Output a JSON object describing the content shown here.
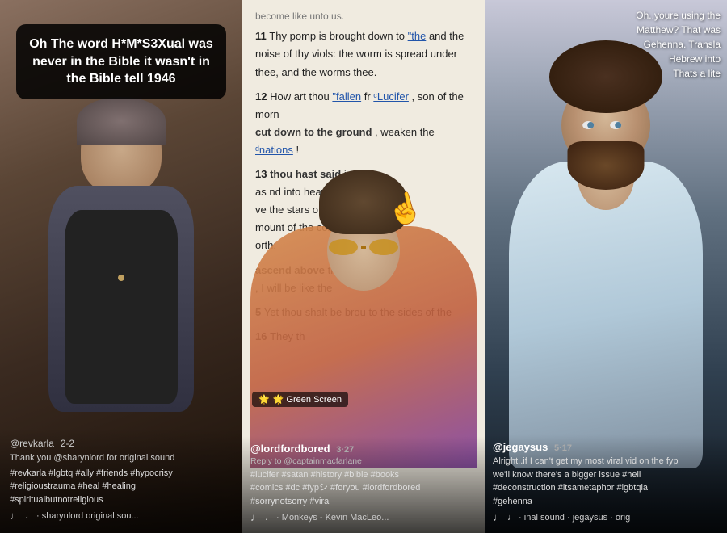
{
  "panels": {
    "panel1": {
      "bubble_text": "Oh The word H*M*S3Xual was never in the Bible it wasn't in the Bible tell 1946",
      "username": "@revkarla",
      "date": "2-2",
      "credit": "Thank you @sharynlord for original sound",
      "caption": "#revkarla #lgbtq #ally #friends #hypocrisy\n#religioustrauma #heal #healing\n#spiritualbutnotreligious",
      "music": "♩ · sharynlord   original sou..."
    },
    "panel2": {
      "top_text": "become like unto us.",
      "verse11_num": "11",
      "verse11_text": "Thy pomp is brought down to ",
      "verse11_highlight": "\"the",
      "verse11_cont": " and the noise of thy viols: the worm is spread under thee, and the worms thee.",
      "verse12_num": "12",
      "verse12_text": "How art thou ",
      "verse12_fallen": "\"fallen",
      "verse12_text2": " fr",
      "verse12_lucifer": "ᶜLucifer",
      "verse12_text3": ", son of the morn cut down to the ground, weaken the ",
      "verse12_nations": "ᵈnations",
      "verse13_num": "13",
      "verse13_text": "r thou hast said i",
      "verse13_text2": "as nd into heaven, I w ve the stars of God, mount of the congr orth:",
      "verse14_num": "",
      "verse14_text": "ascend above t",
      "verse14_text2": ", I will be like the",
      "verse15_num": "5",
      "verse15_text": "Yet thou shalt be brou to the sides of the",
      "verse16_num": "16",
      "verse16_text": "They th",
      "green_screen_label": "🌟 Green Screen",
      "username": "@lordfordbored",
      "date": "3·27",
      "reply": "Reply to @captainmacfarlane",
      "caption": "#lucifer #satan #history #bible #books\n#comics #dc #fypシ #foryou #lordfordbored\n#sorrynotsorry #viral",
      "music": "♩ · Monkeys - Kevin MacLeo..."
    },
    "panel3": {
      "top_text": "Oh..youre using the\nMatthew? That was\nGehenna. Transla\nHebrew into\nThats a lite",
      "username": "@jegaysus",
      "date": "5·17",
      "caption": "Alright..if I can't get my most viral vid on the fyp\nwe'll know there's a bigger issue #hell\n#deconstruction #itsametaphor #lgbtqia\n#gehenna",
      "music": "♩ · inal sound · jegaysus · orig"
    }
  }
}
